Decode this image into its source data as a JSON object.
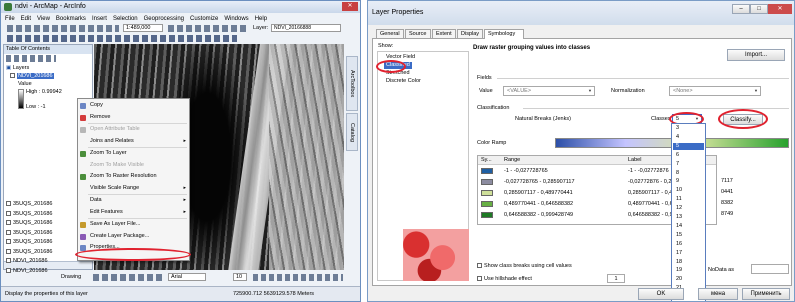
{
  "arcmap": {
    "title": "ndvi - ArcMap - ArcInfo",
    "menu": [
      "File",
      "Edit",
      "View",
      "Bookmarks",
      "Insert",
      "Selection",
      "Geoprocessing",
      "Customize",
      "Windows",
      "Help"
    ],
    "scale": "1:489,000",
    "layer_label": "Layer:",
    "layer_value": "NDVI_20166888",
    "toc_title": "Table Of Contents",
    "toc": {
      "root": "Layers",
      "selected_layer": "NDVI_201686",
      "value_label": "Value",
      "high": "High : 0.99942",
      "low": "Low : -1",
      "layers": [
        "35UQS_201686",
        "35UQS_201686",
        "35UQS_201686",
        "35UQS_201686",
        "35UQS_201686",
        "35UQS_201686",
        "NDVI_201686",
        "NDVI_201686"
      ]
    },
    "context_menu": [
      {
        "label": "Copy",
        "enabled": true,
        "icon": "copy-icon"
      },
      {
        "label": "Remove",
        "enabled": true,
        "icon": "remove-icon"
      },
      {
        "label": "Open Attribute Table",
        "enabled": false,
        "icon": "table-icon"
      },
      {
        "label": "Joins and Relates",
        "enabled": true,
        "icon": ""
      },
      {
        "label": "Zoom To Layer",
        "enabled": true,
        "icon": "zoom-layer-icon"
      },
      {
        "label": "Zoom To Make Visible",
        "enabled": false,
        "icon": ""
      },
      {
        "label": "Zoom To Raster Resolution",
        "enabled": true,
        "icon": "zoom-raster-icon"
      },
      {
        "label": "Visible Scale Range",
        "enabled": true,
        "icon": ""
      },
      {
        "label": "Data",
        "enabled": true,
        "icon": ""
      },
      {
        "label": "Edit Features",
        "enabled": true,
        "icon": ""
      },
      {
        "label": "Save As Layer File...",
        "enabled": true,
        "icon": "save-layer-icon"
      },
      {
        "label": "Create Layer Package...",
        "enabled": true,
        "icon": "package-icon"
      },
      {
        "label": "Properties...",
        "enabled": true,
        "icon": "properties-icon"
      }
    ],
    "drawing_label": "Drawing",
    "font_name": "Arial",
    "font_size": "10",
    "status_text": "Display the properties of this layer",
    "coords": "725900.712  5639129.578 Meters",
    "side_tabs": [
      "ArcToolbox",
      "Catalog"
    ]
  },
  "layer_props": {
    "title": "Layer Properties",
    "tabs": [
      "General",
      "Source",
      "Extent",
      "Display",
      "Symbology"
    ],
    "active_tab": "Symbology",
    "show_label": "Show:",
    "show_items": [
      "Vector Field",
      "Classified",
      "Stretched",
      "Discrete Color"
    ],
    "show_selected": "Classified",
    "header": "Draw raster grouping values into classes",
    "import_btn": "Import...",
    "fields_label": "Fields",
    "value_label": "Value",
    "value_combo": "<VALUE>",
    "normalization_label": "Normalization",
    "normalization_combo": "<None>",
    "classification_label": "Classification",
    "method": "Natural Breaks (Jenks)",
    "classes_label": "Classes",
    "classes_value": "5",
    "classify_btn": "Classify...",
    "color_ramp_label": "Color Ramp",
    "grid_headers": [
      "Sy...",
      "Range",
      "Label"
    ],
    "grid_rows": [
      {
        "range": "-1 - -0,027728765",
        "label": "-1 - -0,02772876",
        "color": "#1f5fa3"
      },
      {
        "range": "-0,027728765 - 0,285907117",
        "label": "-0,02772876 - 0,2",
        "color": "#8c8ca0"
      },
      {
        "range": "0,285907117 - 0,489770441",
        "label": "0,285907117 - 0,4",
        "color": "#cfe09a"
      },
      {
        "range": "0,489770441 - 0,646588382",
        "label": "0,489770441 - 0,6",
        "color": "#67b043"
      },
      {
        "range": "0,646588382 - 0,999428749",
        "label": "0,646588382 - 0,9",
        "color": "#1e7a25"
      }
    ],
    "right_col": [
      "7117",
      "0441",
      "8382",
      "8749"
    ],
    "classes_options": [
      "3",
      "4",
      "5",
      "6",
      "7",
      "8",
      "9",
      "10",
      "11",
      "12",
      "13",
      "14",
      "15",
      "16",
      "17",
      "18",
      "19",
      "20",
      "21",
      "22"
    ],
    "show_breaks_label": "Show class breaks using cell values",
    "hillshade_label": "Use hillshade effect",
    "nodata_label": "NoData as",
    "ok_btn": "OK",
    "cancel_btn": "мена",
    "apply_btn": "Применить",
    "window_buttons": [
      "–",
      "□",
      "✕"
    ]
  }
}
